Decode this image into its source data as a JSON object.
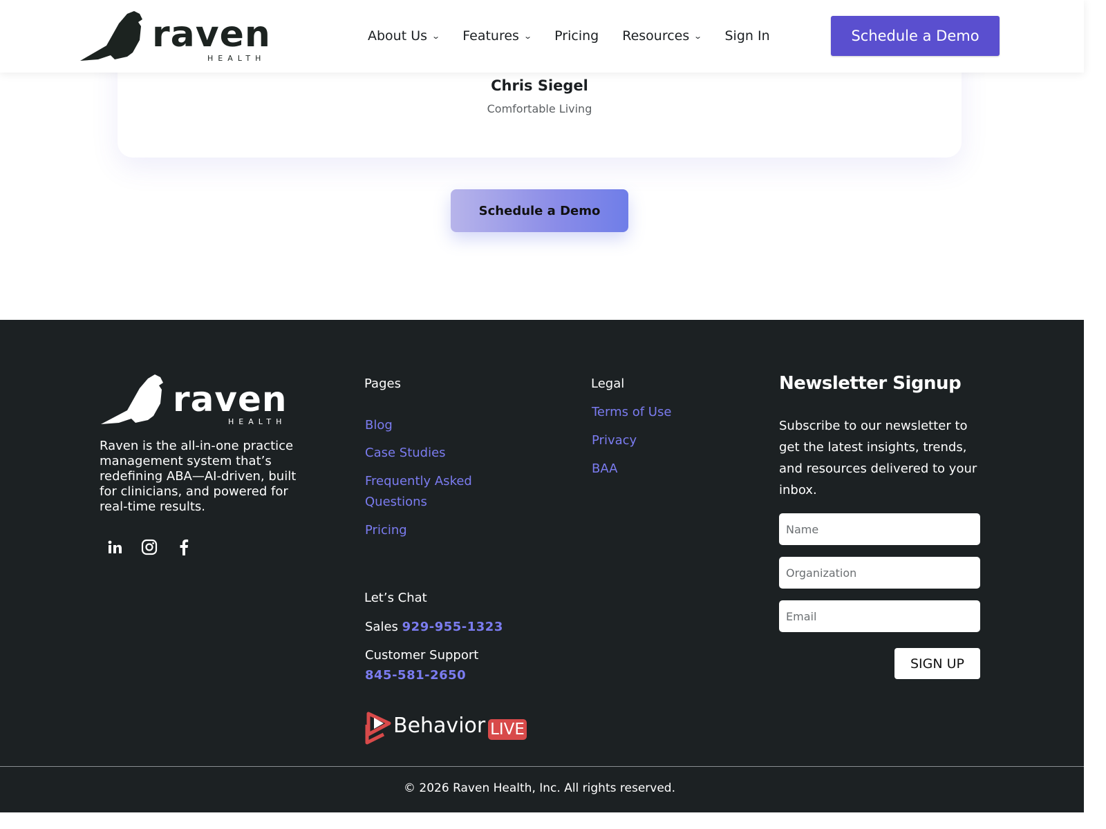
{
  "header": {
    "logo_text": "raven",
    "logo_sub": "HEALTH",
    "nav": [
      {
        "label": "About Us",
        "has_dropdown": true
      },
      {
        "label": "Features",
        "has_dropdown": true
      },
      {
        "label": "Pricing",
        "has_dropdown": false
      },
      {
        "label": "Resources",
        "has_dropdown": true
      },
      {
        "label": "Sign In",
        "has_dropdown": false
      }
    ],
    "cta_label": "Schedule a Demo"
  },
  "testimonial": {
    "name": "Chris Siegel",
    "company": "Comfortable Living"
  },
  "cta_mid_label": "Schedule a Demo",
  "footer": {
    "logo_text": "raven",
    "logo_sub": "HEALTH",
    "description": "Raven is the all-in-one practice management system that’s redefining ABA—AI-driven, built for clinicians, and powered for real-time results.",
    "social_icons": [
      "linkedin-icon",
      "instagram-icon",
      "facebook-icon"
    ],
    "pages": {
      "heading": "Pages",
      "links": [
        "Blog",
        "Case Studies",
        "Frequently Asked Questions",
        "Pricing"
      ]
    },
    "legal": {
      "heading": "Legal",
      "links": [
        "Terms of Use",
        "Privacy",
        "BAA"
      ]
    },
    "chat": {
      "heading": "Let’s Chat",
      "sales_label": "Sales",
      "sales_phone": "929-955-1323",
      "support_label": "Customer Support",
      "support_phone": "845-581-2650"
    },
    "partner": {
      "word": "Behavior",
      "badge": "LIVE"
    },
    "newsletter": {
      "title": "Newsletter Signup",
      "text": "Subscribe to our newsletter to get the latest insights, trends, and resources delivered to your inbox.",
      "name_placeholder": "Name",
      "org_placeholder": "Organization",
      "email_placeholder": "Email",
      "button_label": "SIGN UP"
    },
    "copyright": "2026 Raven Health, Inc. All rights reserved.",
    "copyright_symbol": "©"
  },
  "colors": {
    "accent": "#5a4fcf",
    "link": "#7b7cf0",
    "footer_bg": "#1c2123",
    "live_red": "#d84a4a"
  }
}
